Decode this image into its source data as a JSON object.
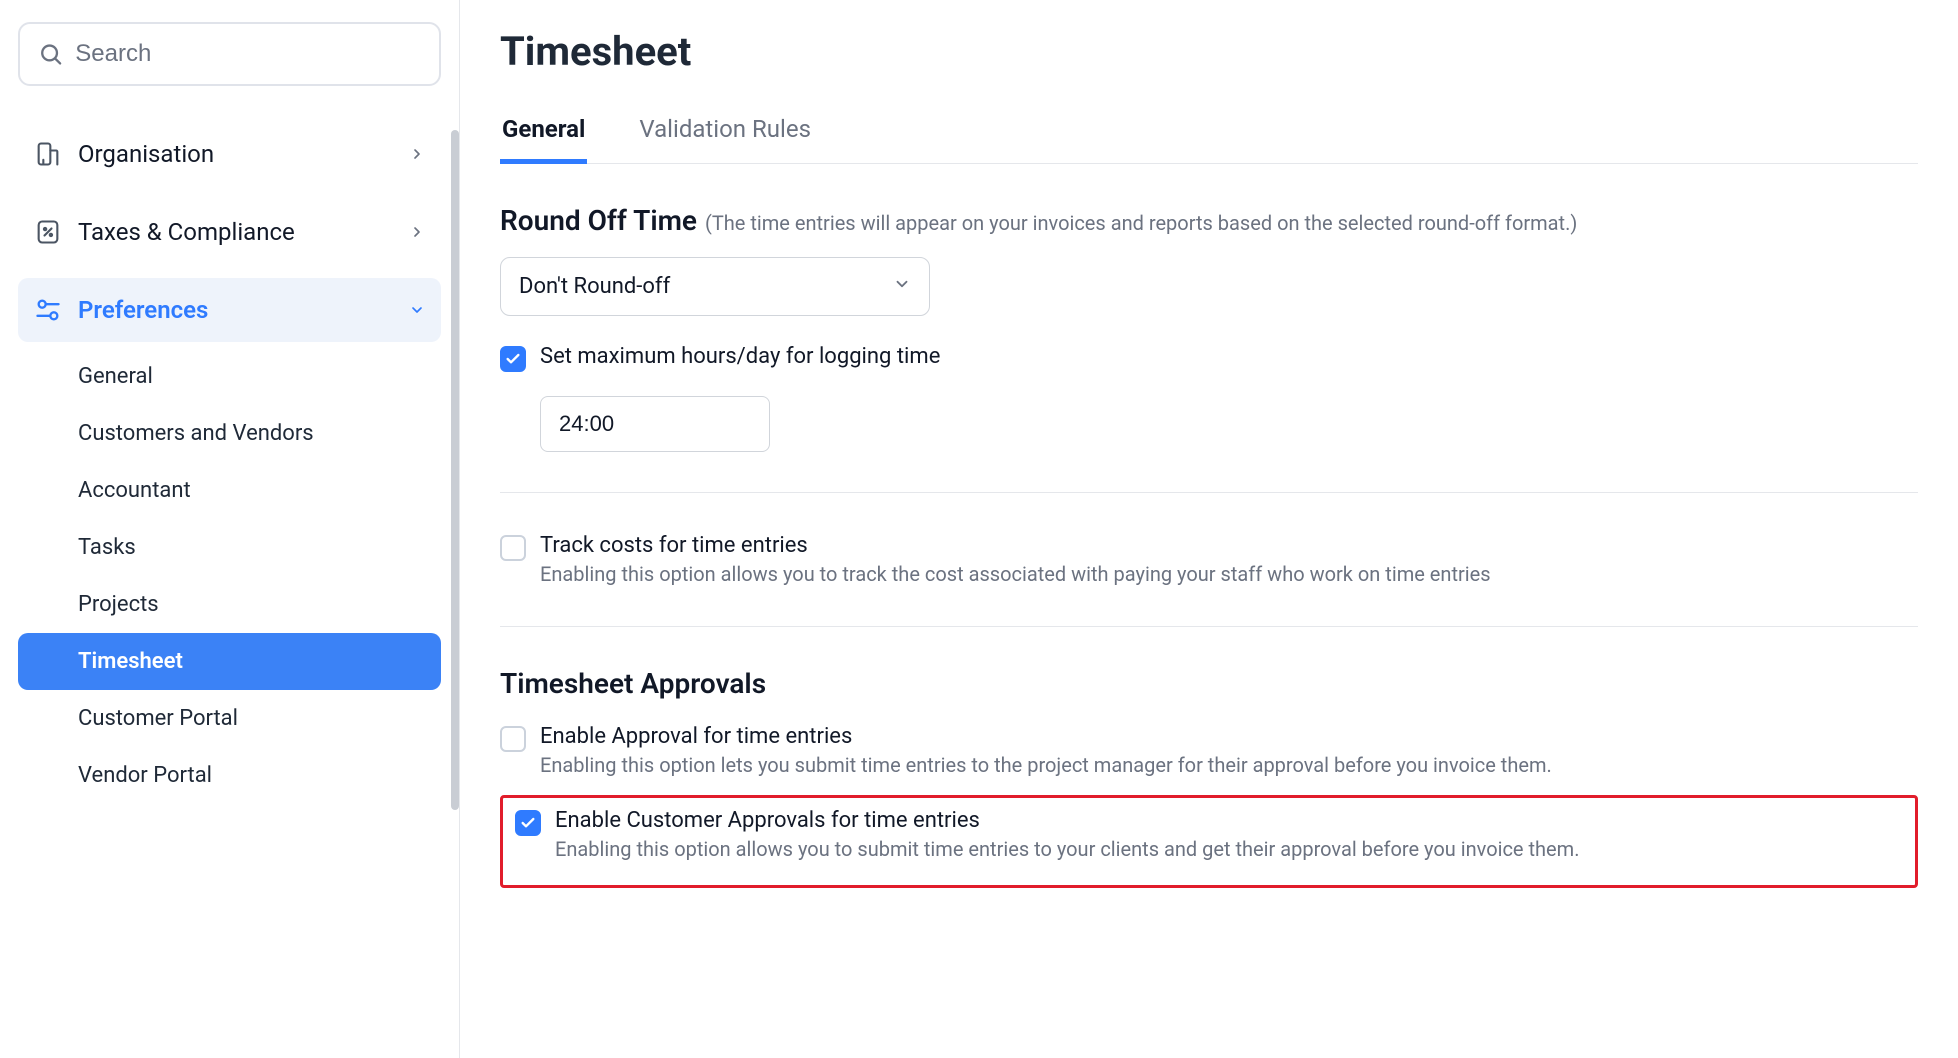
{
  "sidebar": {
    "search_placeholder": "Search",
    "groups": [
      {
        "id": "organisation",
        "label": "Organisation",
        "expandable": true
      },
      {
        "id": "taxes",
        "label": "Taxes & Compliance",
        "expandable": true
      },
      {
        "id": "preferences",
        "label": "Preferences",
        "expandable": true,
        "expanded": true,
        "active": true
      }
    ],
    "preferences_items": [
      {
        "id": "general",
        "label": "General"
      },
      {
        "id": "customers",
        "label": "Customers and Vendors"
      },
      {
        "id": "accountant",
        "label": "Accountant"
      },
      {
        "id": "tasks",
        "label": "Tasks"
      },
      {
        "id": "projects",
        "label": "Projects"
      },
      {
        "id": "timesheet",
        "label": "Timesheet",
        "selected": true
      },
      {
        "id": "customer-portal",
        "label": "Customer Portal"
      },
      {
        "id": "vendor-portal",
        "label": "Vendor Portal"
      }
    ]
  },
  "main": {
    "title": "Timesheet",
    "tabs": [
      {
        "id": "general",
        "label": "General",
        "active": true
      },
      {
        "id": "validation",
        "label": "Validation Rules",
        "active": false
      }
    ],
    "round_off": {
      "title": "Round Off Time",
      "hint": "(The time entries will appear on your invoices and reports based on the selected round-off format.)",
      "select_value": "Don't Round-off",
      "max_hours_label": "Set maximum hours/day for logging time",
      "max_hours_checked": true,
      "max_hours_value": "24:00"
    },
    "track_costs": {
      "label": "Track costs for time entries",
      "desc": "Enabling this option allows you to track the cost associated with paying your staff who work on time entries",
      "checked": false
    },
    "approvals": {
      "title": "Timesheet Approvals",
      "enable_approval": {
        "label": "Enable Approval for time entries",
        "desc": "Enabling this option lets you submit time entries to the project manager for their approval before you invoice them.",
        "checked": false
      },
      "enable_customer_approval": {
        "label": "Enable Customer Approvals for time entries",
        "desc": "Enabling this option allows you to submit time entries to your clients and get their approval before you invoice them.",
        "checked": true
      }
    }
  }
}
